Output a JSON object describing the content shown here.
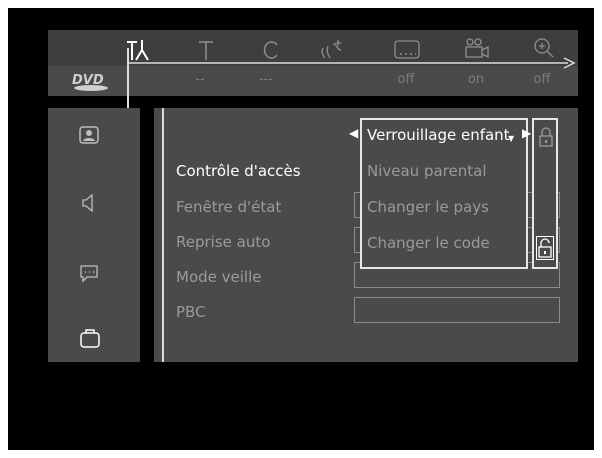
{
  "logo": "DVD",
  "top_icons": [
    "settings-tools-icon",
    "title-icon",
    "chapter-icon",
    "audio-icon",
    "subtitle-icon",
    "angle-icon",
    "zoom-icon"
  ],
  "status_values": [
    "--",
    "---",
    "off",
    "on",
    "off"
  ],
  "side_icons": [
    "picture-icon",
    "sound-icon",
    "language-icon",
    "features-icon"
  ],
  "menu": {
    "items": [
      "Contrôle d'accès",
      "Fenêtre d'état",
      "Reprise auto",
      "Mode veille",
      "PBC"
    ]
  },
  "popup": {
    "items": [
      "Verrouillage enfant",
      "Niveau parental",
      "Changer le pays",
      "Changer le code"
    ]
  },
  "colors": {
    "panel": "#4a4a4a",
    "background": "#000000",
    "active_text": "#ffffff",
    "dim_text": "#9a9a9a"
  }
}
